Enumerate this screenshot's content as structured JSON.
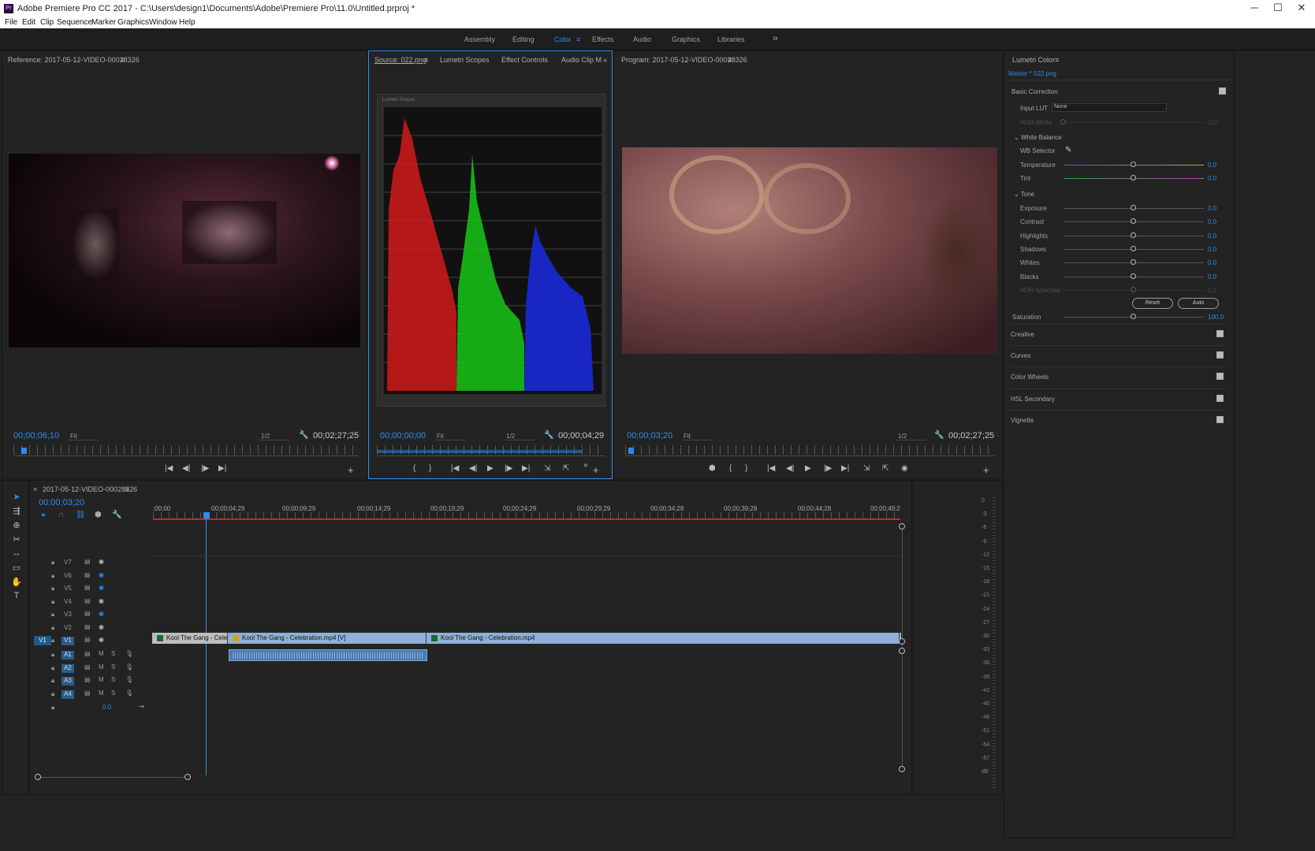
{
  "window": {
    "title": "Adobe Premiere Pro CC 2017 - C:\\Users\\design1\\Documents\\Adobe\\Premiere Pro\\11.0\\Untitled.prproj *",
    "app_icon": "Pr",
    "minimize": "─",
    "maximize": "☐",
    "close": "✕"
  },
  "menu": [
    "File",
    "Edit",
    "Clip",
    "Sequence",
    "Marker",
    "Graphics",
    "Window",
    "Help"
  ],
  "workspaces": {
    "items": [
      "Assembly",
      "Editing",
      "Color",
      "Effects",
      "Audio",
      "Graphics",
      "Libraries"
    ],
    "active": "Color",
    "menu_icon": "≡",
    "overflow": "»"
  },
  "reference": {
    "title": "Reference: 2017-05-12-VIDEO-00028326",
    "menu": "≡",
    "timecode": "00;00;06;10",
    "fit": "Fit",
    "resolution": "1/2",
    "duration": "00;02;27;25"
  },
  "source": {
    "tabs": [
      "Source: 022.png",
      "Lumetri Scopes",
      "Effect Controls",
      "Audio Clip M"
    ],
    "menu": "≡",
    "overflow": "»",
    "scope_label": "Lumetri Scopes",
    "timecode": "00;00;00;00",
    "fit": "Fit",
    "resolution": "1/2",
    "duration": "00;00;04;29"
  },
  "program": {
    "title": "Program: 2017-05-12-VIDEO-00028326",
    "menu": "≡",
    "timecode": "00;00;03;20",
    "fit": "Fit",
    "resolution": "1/2",
    "duration": "00;02;27;25"
  },
  "transport": {
    "mark_in": "{",
    "mark_out": "}",
    "go_in": "|◀",
    "step_back": "◀|",
    "play": "▶",
    "step_fwd": "|▶",
    "go_out": "▶|",
    "add": "+",
    "marker": "⬢",
    "camera": "◉",
    "wrench": "🔧",
    "insert": "⇲",
    "overwrite": "⇱"
  },
  "lumetri": {
    "title": "Lumetri Color",
    "menu": "≡",
    "clip": "Master * 022.png",
    "basic": "Basic Correction",
    "input_lut_label": "Input LUT",
    "input_lut_value": "None",
    "hdr_white": "HDR White",
    "hdr_white_val": "100",
    "white_balance": "White Balance",
    "wb_selector": "WB Selector",
    "wb": [
      {
        "label": "Temperature",
        "value": "0.0"
      },
      {
        "label": "Tint",
        "value": "0.0"
      }
    ],
    "tone": "Tone",
    "tone_items": [
      {
        "label": "Exposure",
        "value": "0.0"
      },
      {
        "label": "Contrast",
        "value": "0.0"
      },
      {
        "label": "Highlights",
        "value": "0.0"
      },
      {
        "label": "Shadows",
        "value": "0.0"
      },
      {
        "label": "Whites",
        "value": "0.0"
      },
      {
        "label": "Blacks",
        "value": "0.0"
      },
      {
        "label": "HDR Specular",
        "value": "0.0"
      }
    ],
    "reset": "Reset",
    "auto": "Auto",
    "saturation": "Saturation",
    "saturation_val": "100.0",
    "sections": [
      "Creative",
      "Curves",
      "Color Wheels",
      "HSL Secondary",
      "Vignette"
    ]
  },
  "timeline": {
    "title": "2017-05-12-VIDEO-00028326",
    "close": "×",
    "menu": "≡",
    "timecode": "00;00;03;20",
    "ruler": [
      ";00;00",
      "00;00;04;29",
      "00;00;09;29",
      "00;00;14;29",
      "00;00;19;29",
      "00;00;24;29",
      "00;00;29;29",
      "00;00;34;28",
      "00;00;39;28",
      "00;00;44;28",
      "00;00;49;2"
    ],
    "video_tracks": [
      "V7",
      "V6",
      "V5",
      "V4",
      "V3",
      "V2",
      "V1"
    ],
    "audio_tracks": [
      "A1",
      "A2",
      "A3",
      "A4"
    ],
    "src_v": "V1",
    "master_val": "0.0",
    "mute": "M",
    "solo": "S",
    "clips": [
      "Kool  The Gang - Celebr",
      "Kool  The Gang - Celebration.mp4 [V]",
      "Kool  The Gang - Celebration.mp4"
    ]
  },
  "vu_labels": [
    "0",
    "-3",
    "-6",
    "-9",
    "-12",
    "-15",
    "-18",
    "-21",
    "-24",
    "-27",
    "-30",
    "-33",
    "-36",
    "-39",
    "-42",
    "-45",
    "-48",
    "-51",
    "-54",
    "-57",
    "dB"
  ]
}
